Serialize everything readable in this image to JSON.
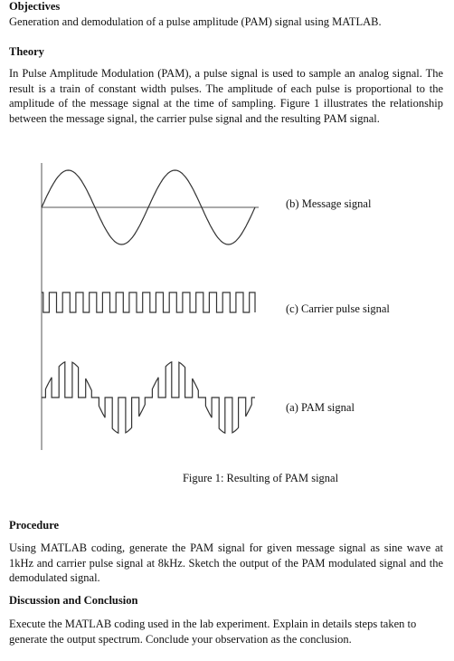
{
  "objectives": {
    "heading": "Objectives",
    "text": "Generation and demodulation of a pulse amplitude (PAM) signal using MATLAB."
  },
  "theory": {
    "heading": "Theory",
    "text": "In Pulse Amplitude Modulation (PAM), a pulse signal is used to sample an analog signal. The result is a train of constant width pulses. The amplitude of each pulse is proportional to the amplitude of the message signal at the time of sampling. Figure 1 illustrates the relationship between the message signal, the carrier pulse signal and the resulting PAM signal."
  },
  "figure": {
    "labels": {
      "message": "(b) Message signal",
      "carrier": "(c) Carrier pulse signal",
      "pam": "(a) PAM signal"
    },
    "caption": "Figure 1: Resulting of PAM signal",
    "message_cycles": 2,
    "carrier_pulses": 16,
    "stroke_color": "#333333"
  },
  "procedure": {
    "heading": "Procedure",
    "text": "Using MATLAB coding, generate the PAM signal for given message signal as sine wave at 1kHz and carrier pulse signal at 8kHz. Sketch the output of the PAM modulated signal and the demodulated signal."
  },
  "discussion": {
    "heading": "Discussion and Conclusion",
    "text": "Execute the MATLAB coding used in the lab experiment. Explain in details steps taken to generate the output spectrum. Conclude your observation as the conclusion."
  }
}
